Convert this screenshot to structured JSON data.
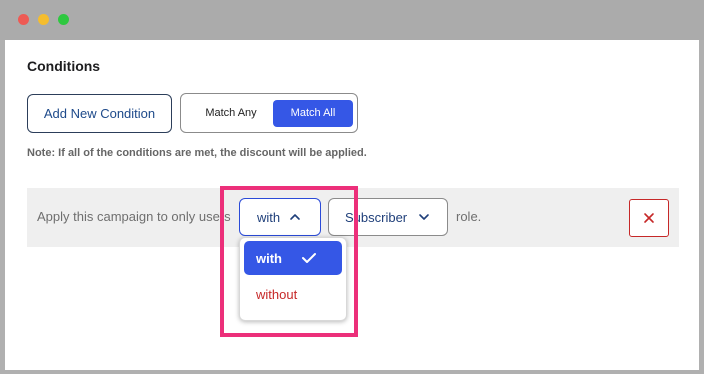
{
  "window": {
    "controls": [
      "close",
      "minimize",
      "maximize"
    ],
    "colors": {
      "close": "#ee5a54",
      "minimize": "#f5bd2e",
      "maximize": "#2ec840"
    }
  },
  "section": {
    "title": "Conditions"
  },
  "buttons": {
    "add_condition": "Add New Condition",
    "match_any": "Match Any",
    "match_all": "Match All"
  },
  "note": "Note: If all of the conditions are met, the discount will be applied.",
  "condition": {
    "prefix": "Apply this campaign to only users",
    "with_select": {
      "value": "with"
    },
    "role_select": {
      "value": "Subscriber"
    },
    "suffix": "role."
  },
  "dropdown": {
    "options": [
      {
        "label": "with",
        "selected": true
      },
      {
        "label": "without",
        "selected": false
      }
    ]
  },
  "colors": {
    "accent": "#3557e6",
    "danger": "#c62828",
    "highlight": "#ec2f7a"
  },
  "icons": {
    "with_chevron": "chevron-up-icon",
    "role_chevron": "chevron-down-icon",
    "delete": "close-icon",
    "selected": "checkmark-icon"
  }
}
